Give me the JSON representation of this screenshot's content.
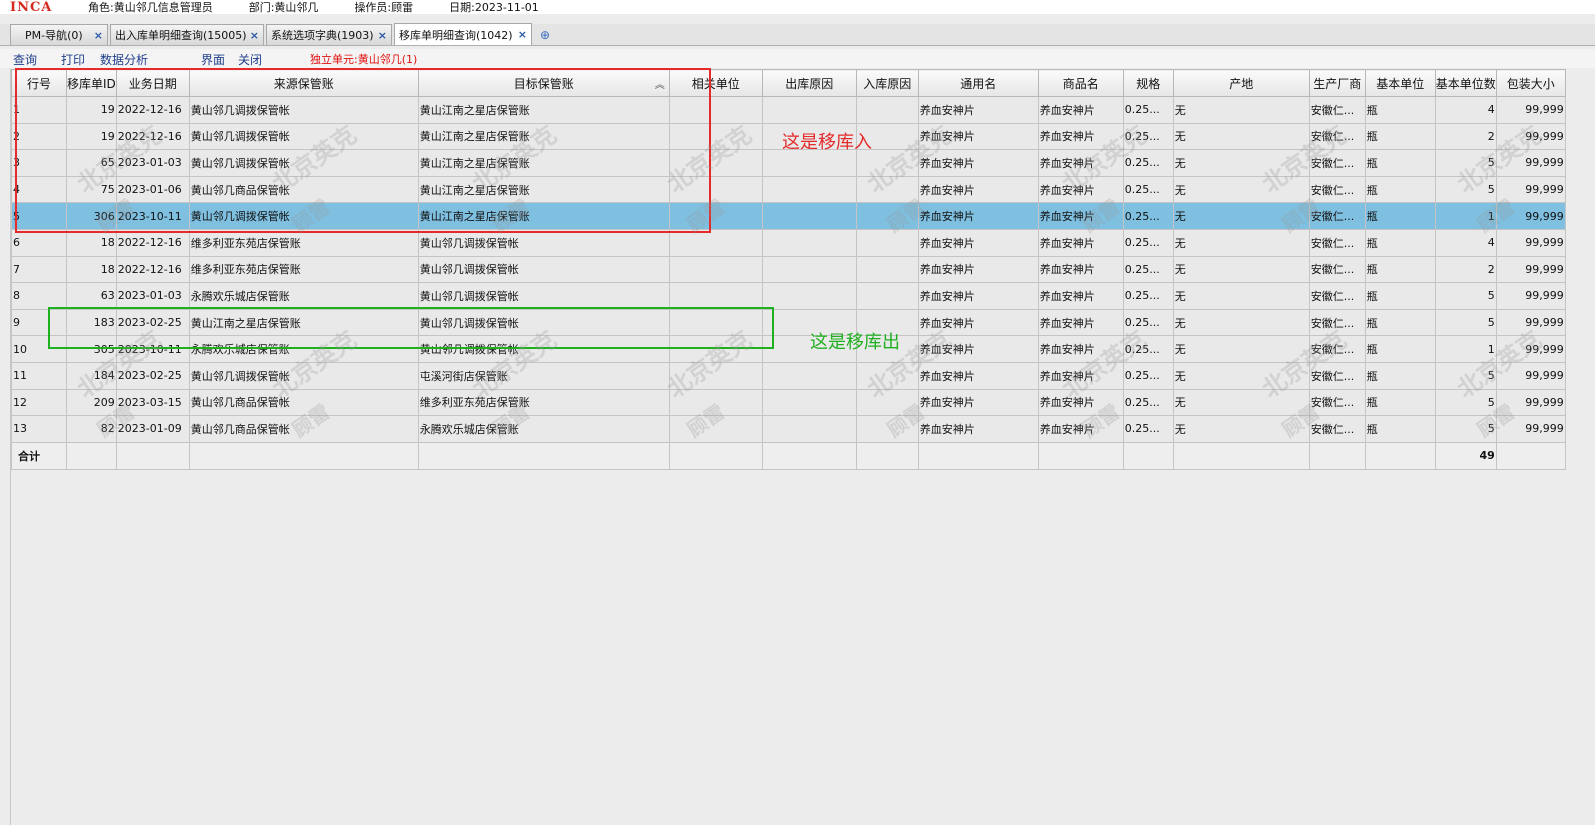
{
  "header": {
    "logo": "INCA",
    "role": "角色:黄山邻几信息管理员",
    "dept": "部门:黄山邻几",
    "operator": "操作员:顾雷",
    "date": "日期:2023-11-01"
  },
  "tabs": [
    {
      "label": "PM-导航(0)",
      "close": "×"
    },
    {
      "label": "出入库单明细查询(15005)",
      "close": "×"
    },
    {
      "label": "系统选项字典(1903)",
      "close": "×"
    },
    {
      "label": "移库单明细查询(1042)",
      "close": "×"
    }
  ],
  "menu": {
    "query": "查询",
    "print": "打印",
    "analysis": "数据分析",
    "ui": "界面",
    "close": "关闭",
    "unit": "独立单元:黄山邻几(1)"
  },
  "columns": [
    "行号",
    "移库单ID",
    "业务日期",
    "来源保管账",
    "目标保管账",
    "相关单位",
    "出库原因",
    "入库原因",
    "通用名",
    "商品名",
    "规格",
    "产地",
    "生产厂商",
    "基本单位",
    "基本单位数",
    "包装大小"
  ],
  "rows": [
    [
      "1",
      "19",
      "2022-12-16",
      "黄山邻几调拨保管帐",
      "黄山江南之星店保管账",
      "",
      "",
      "",
      "养血安神片",
      "养血安神片",
      "0.25...",
      "无",
      "安徽仁...",
      "瓶",
      "4",
      "99,999"
    ],
    [
      "2",
      "19",
      "2022-12-16",
      "黄山邻几调拨保管帐",
      "黄山江南之星店保管账",
      "",
      "",
      "",
      "养血安神片",
      "养血安神片",
      "0.25...",
      "无",
      "安徽仁...",
      "瓶",
      "2",
      "99,999"
    ],
    [
      "3",
      "65",
      "2023-01-03",
      "黄山邻几调拨保管帐",
      "黄山江南之星店保管账",
      "",
      "",
      "",
      "养血安神片",
      "养血安神片",
      "0.25...",
      "无",
      "安徽仁...",
      "瓶",
      "5",
      "99,999"
    ],
    [
      "4",
      "75",
      "2023-01-06",
      "黄山邻几商品保管帐",
      "黄山江南之星店保管账",
      "",
      "",
      "",
      "养血安神片",
      "养血安神片",
      "0.25...",
      "无",
      "安徽仁...",
      "瓶",
      "5",
      "99,999"
    ],
    [
      "5",
      "306",
      "2023-10-11",
      "黄山邻几调拨保管帐",
      "黄山江南之星店保管账",
      "",
      "",
      "",
      "养血安神片",
      "养血安神片",
      "0.25...",
      "无",
      "安徽仁...",
      "瓶",
      "1",
      "99,999"
    ],
    [
      "6",
      "18",
      "2022-12-16",
      "维多利亚东苑店保管账",
      "黄山邻几调拨保管帐",
      "",
      "",
      "",
      "养血安神片",
      "养血安神片",
      "0.25...",
      "无",
      "安徽仁...",
      "瓶",
      "4",
      "99,999"
    ],
    [
      "7",
      "18",
      "2022-12-16",
      "维多利亚东苑店保管账",
      "黄山邻几调拨保管帐",
      "",
      "",
      "",
      "养血安神片",
      "养血安神片",
      "0.25...",
      "无",
      "安徽仁...",
      "瓶",
      "2",
      "99,999"
    ],
    [
      "8",
      "63",
      "2023-01-03",
      "永腾欢乐城店保管账",
      "黄山邻几调拨保管帐",
      "",
      "",
      "",
      "养血安神片",
      "养血安神片",
      "0.25...",
      "无",
      "安徽仁...",
      "瓶",
      "5",
      "99,999"
    ],
    [
      "9",
      "183",
      "2023-02-25",
      "黄山江南之星店保管账",
      "黄山邻几调拨保管帐",
      "",
      "",
      "",
      "养血安神片",
      "养血安神片",
      "0.25...",
      "无",
      "安徽仁...",
      "瓶",
      "5",
      "99,999"
    ],
    [
      "10",
      "305",
      "2023-10-11",
      "永腾欢乐城店保管账",
      "黄山邻几调拨保管帐",
      "",
      "",
      "",
      "养血安神片",
      "养血安神片",
      "0.25...",
      "无",
      "安徽仁...",
      "瓶",
      "1",
      "99,999"
    ],
    [
      "11",
      "184",
      "2023-02-25",
      "黄山邻几调拨保管帐",
      "屯溪河街店保管账",
      "",
      "",
      "",
      "养血安神片",
      "养血安神片",
      "0.25...",
      "无",
      "安徽仁...",
      "瓶",
      "5",
      "99,999"
    ],
    [
      "12",
      "209",
      "2023-03-15",
      "黄山邻几商品保管帐",
      "维多利亚东苑店保管账",
      "",
      "",
      "",
      "养血安神片",
      "养血安神片",
      "0.25...",
      "无",
      "安徽仁...",
      "瓶",
      "5",
      "99,999"
    ],
    [
      "13",
      "82",
      "2023-01-09",
      "黄山邻几商品保管帐",
      "永腾欢乐城店保管账",
      "",
      "",
      "",
      "养血安神片",
      "养血安神片",
      "0.25...",
      "无",
      "安徽仁...",
      "瓶",
      "5",
      "99,999"
    ]
  ],
  "selected_row": 4,
  "total": {
    "label": "合计",
    "base_unit_qty": "49"
  },
  "annotations": {
    "move_in": "这是移库入",
    "move_out": "这是移库出"
  },
  "watermark": {
    "company": "北京英克",
    "name": "顾雷"
  }
}
